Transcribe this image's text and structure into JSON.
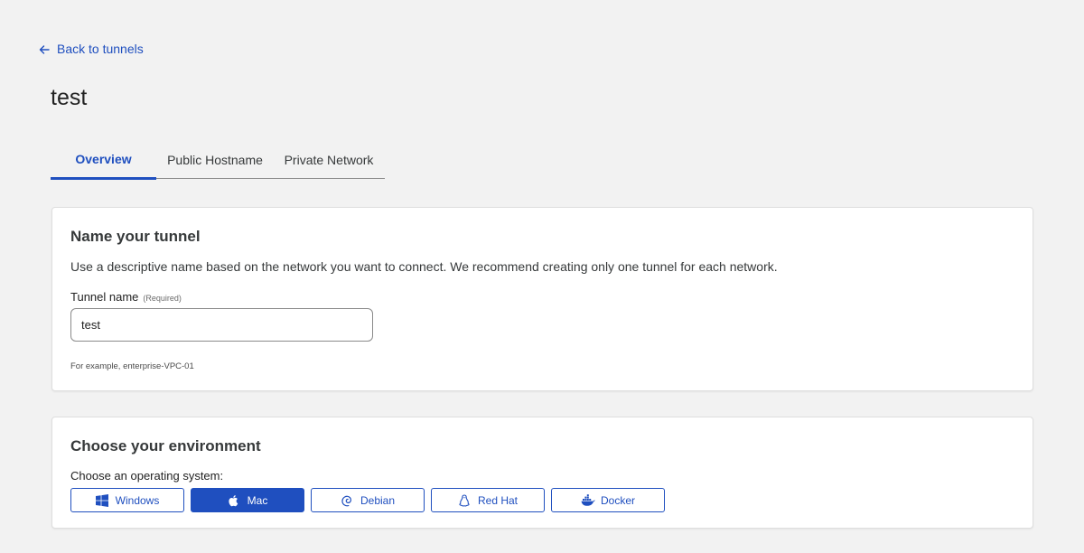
{
  "nav": {
    "back_label": "Back to tunnels"
  },
  "page": {
    "title": "test"
  },
  "tabs": [
    {
      "label": "Overview",
      "active": true
    },
    {
      "label": "Public Hostname",
      "active": false
    },
    {
      "label": "Private Network",
      "active": false
    }
  ],
  "name_card": {
    "heading": "Name your tunnel",
    "description": "Use a descriptive name based on the network you want to connect. We recommend creating only one tunnel for each network.",
    "field_label": "Tunnel name",
    "required_note": "(Required)",
    "field_value": "test",
    "hint": "For example, enterprise-VPC-01"
  },
  "env_card": {
    "heading": "Choose your environment",
    "os_label": "Choose an operating system:",
    "os_options": [
      {
        "label": "Windows",
        "icon": "windows-icon",
        "selected": false
      },
      {
        "label": "Mac",
        "icon": "apple-icon",
        "selected": true
      },
      {
        "label": "Debian",
        "icon": "debian-icon",
        "selected": false
      },
      {
        "label": "Red Hat",
        "icon": "linux-penguin-icon",
        "selected": false
      },
      {
        "label": "Docker",
        "icon": "docker-icon",
        "selected": false
      }
    ]
  },
  "colors": {
    "accent": "#1f4fbf",
    "background": "#f2f2f2",
    "card": "#ffffff"
  }
}
